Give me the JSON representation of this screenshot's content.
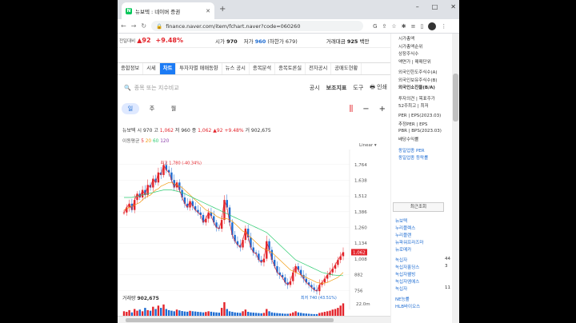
{
  "browser": {
    "tab_title": "뉴보텍 : 네이버 증권",
    "favicon_letter": "N",
    "url": "finance.naver.com/item/fchart.naver?code=060260",
    "controls": [
      "–",
      "□",
      "✕"
    ]
  },
  "stock_bar": {
    "label": "전일대비",
    "change": "▲92",
    "change_pct": "+9.48%",
    "high_label": "시가",
    "high_value": "970",
    "low_label": "저가",
    "low_value": "960",
    "low_note": "(하한가 679)",
    "volume_label": "거래대금",
    "volume_value": "925",
    "volume_unit": "백만"
  },
  "tabs": [
    "종합정보",
    "시세",
    "차트",
    "투자자별 매매동향",
    "뉴스 공시",
    "종목분석",
    "종목토론실",
    "전자공시",
    "공매도현황"
  ],
  "active_tab": "차트",
  "search": {
    "placeholder": "종목 또는 지수비교"
  },
  "tools": {
    "notice": "공시",
    "indicator": "보조지표",
    "tools": "도구",
    "print": "인쇄"
  },
  "periods": [
    "일",
    "주",
    "월"
  ],
  "active_period": "일",
  "info": {
    "name": "뉴보텍",
    "open_label": "시",
    "open": "970",
    "high_label": "고",
    "high": "1,062",
    "low_label": "저",
    "low": "960",
    "close_label": "종",
    "close": "1,062",
    "change": "▲92",
    "pct": "+9.48%",
    "vol_label": "거",
    "vol": "902,675"
  },
  "ma": {
    "label": "이동평균",
    "p5": "5",
    "p20": "20",
    "p60": "60",
    "p120": "120"
  },
  "scale_mode": "Linear",
  "volume_text": {
    "label": "거래량",
    "value": "902,675",
    "axis": "22.0m"
  },
  "chart_data": {
    "type": "line",
    "y_ticks": [
      "1,764",
      "1,638",
      "1,512",
      "1,386",
      "1,260",
      "1,134",
      "1,008",
      "882",
      "756"
    ],
    "current_price": "1,062",
    "max_annotation": "최고 1,780 (-40.34%)",
    "min_annotation": "최저 740 (43.51%)",
    "ylim": [
      700,
      1820
    ],
    "close": [
      1380,
      1420,
      1450,
      1400,
      1480,
      1530,
      1500,
      1560,
      1520,
      1600,
      1580,
      1650,
      1620,
      1700,
      1680,
      1760,
      1720,
      1700,
      1640,
      1580,
      1620,
      1560,
      1500,
      1450,
      1420,
      1470,
      1430,
      1400,
      1380,
      1360,
      1300,
      1330,
      1380,
      1350,
      1300,
      1260,
      1250,
      1320,
      1480,
      1420,
      1300,
      1200,
      1150,
      1120,
      1100,
      1160,
      1250,
      1180,
      1100,
      1060,
      1050,
      1000,
      980,
      1010,
      1150,
      1080,
      1000,
      950,
      900,
      880,
      860,
      820,
      800,
      830,
      900,
      950,
      920,
      880,
      850,
      820,
      800,
      780,
      760,
      750,
      800,
      820,
      850,
      880,
      900,
      930,
      960,
      1000,
      1030,
      1062
    ],
    "ma20": [
      1400,
      1410,
      1420,
      1430,
      1440,
      1450,
      1460,
      1480,
      1500,
      1510,
      1520,
      1540,
      1560,
      1570,
      1590,
      1600,
      1610,
      1620,
      1620,
      1610,
      1600,
      1590,
      1580,
      1560,
      1540,
      1520,
      1500,
      1480,
      1460,
      1440,
      1420,
      1400,
      1390,
      1380,
      1370,
      1350,
      1340,
      1330,
      1330,
      1330,
      1320,
      1310,
      1290,
      1270,
      1250,
      1230,
      1220,
      1200,
      1180,
      1160,
      1140,
      1120,
      1100,
      1090,
      1080,
      1070,
      1060,
      1040,
      1020,
      1000,
      980,
      960,
      940,
      920,
      910,
      900,
      890,
      880,
      870,
      860,
      850,
      840,
      830,
      820,
      815,
      812,
      815,
      820,
      830,
      840,
      850,
      860,
      880,
      900
    ],
    "ma60": [
      1500,
      1500,
      1500,
      1500,
      1505,
      1510,
      1515,
      1520,
      1525,
      1530,
      1535,
      1540,
      1545,
      1550,
      1555,
      1560,
      1560,
      1560,
      1560,
      1555,
      1550,
      1545,
      1540,
      1530,
      1520,
      1510,
      1500,
      1490,
      1480,
      1470,
      1460,
      1450,
      1440,
      1430,
      1420,
      1410,
      1400,
      1390,
      1380,
      1370,
      1360,
      1350,
      1340,
      1330,
      1320,
      1310,
      1300,
      1290,
      1280,
      1270,
      1260,
      1250,
      1240,
      1230,
      1220,
      1200,
      1180,
      1160,
      1140,
      1120,
      1100,
      1080,
      1060,
      1040,
      1020,
      1000,
      990,
      980,
      970,
      960,
      950,
      940,
      930,
      920,
      910,
      900,
      895,
      890,
      885,
      880,
      878,
      876,
      875,
      874
    ],
    "volume": [
      40,
      35,
      50,
      30,
      60,
      45,
      55,
      40,
      70,
      50,
      45,
      80,
      60,
      90,
      70,
      100,
      60,
      50,
      45,
      40,
      55,
      48,
      42,
      38,
      36,
      44,
      40,
      38,
      35,
      33,
      30,
      34,
      40,
      36,
      32,
      30,
      28,
      70,
      120,
      60,
      40,
      35,
      30,
      28,
      26,
      40,
      55,
      35,
      30,
      28,
      26,
      24,
      22,
      26,
      60,
      40,
      30,
      26,
      24,
      22,
      20,
      18,
      18,
      20,
      30,
      40,
      30,
      26,
      22,
      20,
      18,
      16,
      15,
      15,
      25,
      30,
      35,
      40,
      45,
      55,
      60,
      70,
      90,
      110
    ]
  },
  "right_panel": {
    "lines": [
      "시가총액",
      "시가총액순위",
      "상장주식수",
      "액면가 | 매매단위",
      "",
      "외국인한도주식수(A)",
      "외국인보유주식수(B)",
      "외국인소진율(B/A)",
      "",
      "투자의견 | 목표주가",
      "52주최고 | 최저",
      "",
      "PER | EPS(2023.03)",
      "추정PER | EPS",
      "PBR | BPS(2023.03)",
      "배당수익률",
      "",
      "동일업종 PER",
      "동일업종 등락률"
    ],
    "recent_label": "최근조회",
    "recent_items": [
      "뉴보텍",
      "누리플렉스",
      "누리플랜",
      "뉴파워프라즈마",
      "뉴로메카",
      "",
      "녹십자",
      "녹십자홀딩스",
      "녹십자웰빙",
      "녹십자엠에스",
      "녹십자",
      "",
      "NE능률",
      "HLB바이오스"
    ],
    "recent_nums": [
      "",
      "",
      "",
      "",
      "",
      "",
      "44",
      "3",
      "",
      "",
      "11",
      "",
      "",
      ""
    ]
  },
  "colors": {
    "up": "#e3242b",
    "down": "#1c6bd1",
    "accent": "#1c7bf5",
    "ma5": "#e3242b",
    "ma20": "#f39c12",
    "ma60": "#2ecc71",
    "ma120": "#8e44ad"
  }
}
